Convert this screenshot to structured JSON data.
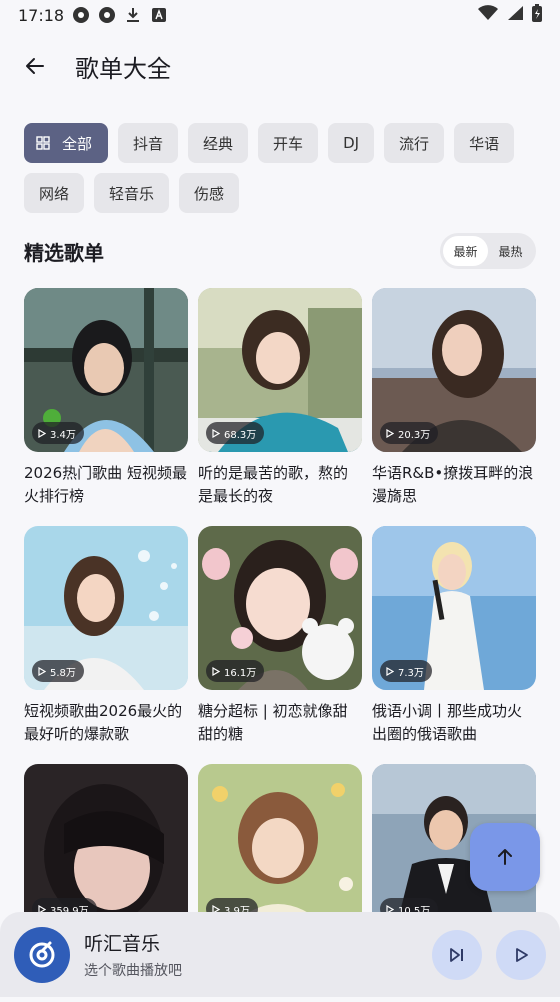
{
  "status": {
    "time": "17:18"
  },
  "header": {
    "title": "歌单大全"
  },
  "filters": [
    {
      "label": "全部",
      "active": true
    },
    {
      "label": "抖音"
    },
    {
      "label": "经典"
    },
    {
      "label": "开车"
    },
    {
      "label": "DJ"
    },
    {
      "label": "流行"
    },
    {
      "label": "华语"
    },
    {
      "label": "网络"
    },
    {
      "label": "轻音乐"
    },
    {
      "label": "伤感"
    }
  ],
  "section": {
    "title": "精选歌单",
    "sort": [
      "最新",
      "最热"
    ],
    "sort_selected": "最新"
  },
  "playlists": [
    {
      "title": "2026热门歌曲 短视频最火排行榜",
      "plays": "3.4万"
    },
    {
      "title": "听的是最苦的歌，熬的是最长的夜",
      "plays": "68.3万"
    },
    {
      "title": "华语R&B•撩拨耳畔的浪漫旖思",
      "plays": "20.3万"
    },
    {
      "title": "短视频歌曲2026最火的最好听的爆款歌",
      "plays": "5.8万"
    },
    {
      "title": "糖分超标 | 初恋就像甜甜的糖",
      "plays": "16.1万"
    },
    {
      "title": "俄语小调丨那些成功火出圈的俄语歌曲",
      "plays": "7.3万"
    },
    {
      "title": "",
      "plays": "359.9万"
    },
    {
      "title": "",
      "plays": "3.9万"
    },
    {
      "title": "",
      "plays": "10.5万"
    }
  ],
  "player": {
    "app_name": "听汇音乐",
    "subtitle": "选个歌曲播放吧"
  },
  "colors": {
    "chip_active": "#5c6284",
    "accent": "#2f5db8",
    "fab": "#7a97e8"
  }
}
